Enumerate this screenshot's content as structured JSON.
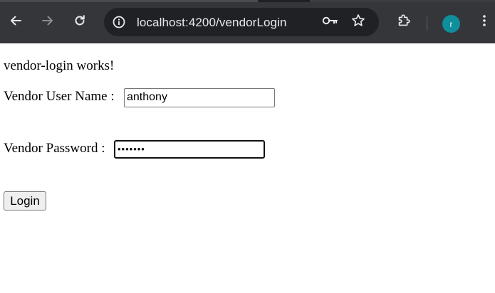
{
  "browser": {
    "url_host": "localhost",
    "url_rest": ":4200/vendorLogin",
    "avatar_letter": "r",
    "avatar_color": "#0e8f9b",
    "icons": [
      "back-arrow-icon",
      "forward-arrow-icon",
      "reload-icon",
      "site-info-icon",
      "key-icon",
      "star-icon",
      "extensions-puzzle-icon",
      "more-vert-icon"
    ]
  },
  "page": {
    "heading": "vendor-login works!",
    "username_label": "Vendor User Name :",
    "username_value": "anthony",
    "password_label": "Vendor Password :",
    "password_masked": "•••••••",
    "login_label": "Login"
  }
}
